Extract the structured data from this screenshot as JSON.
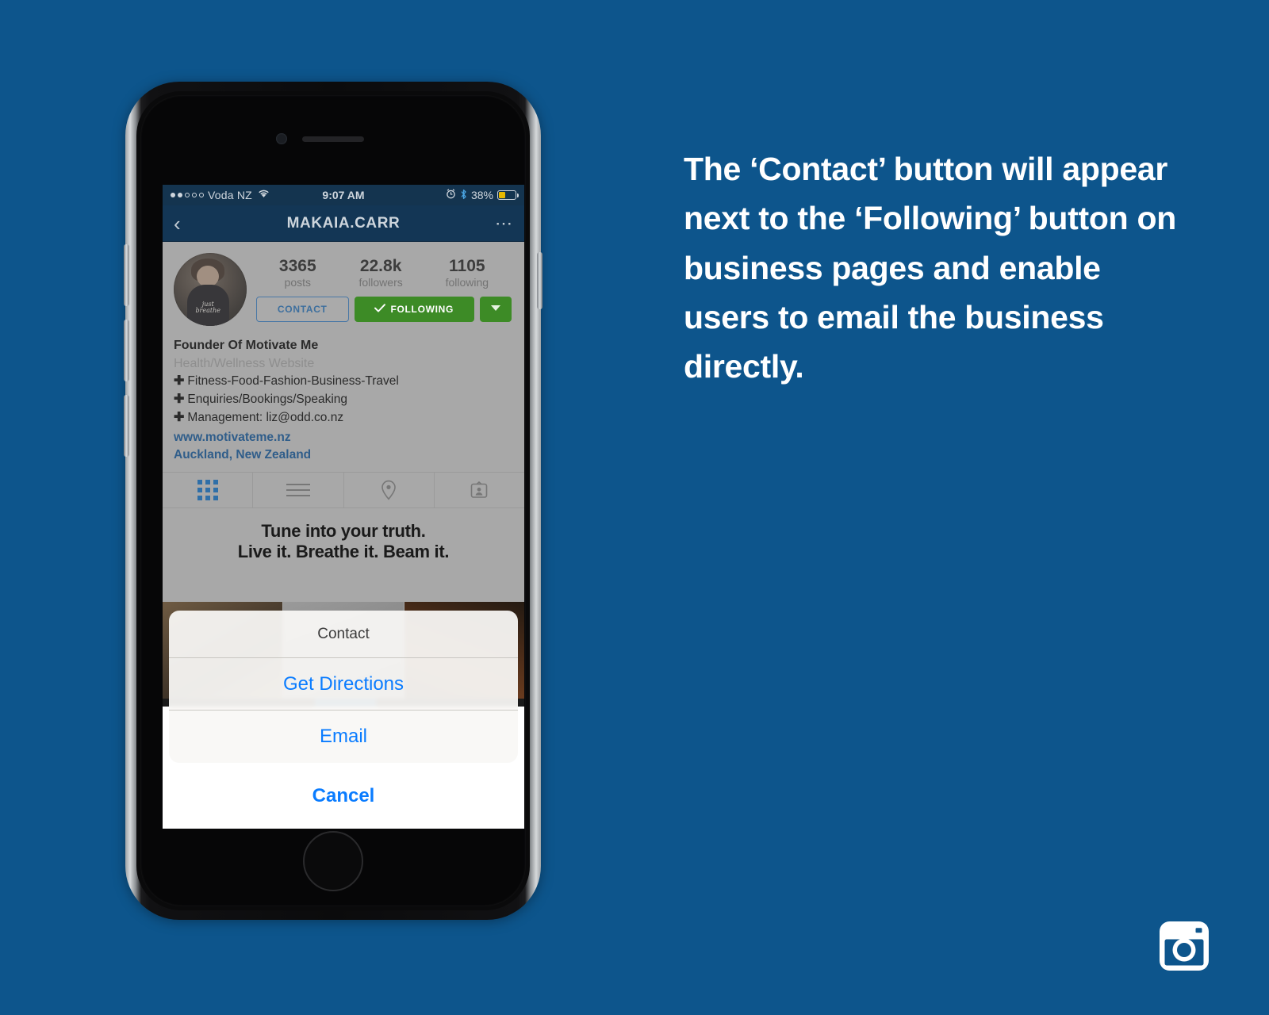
{
  "page": {
    "background_color": "#0d558c",
    "caption": "The ‘Contact’ button will appear next to the ‘Following’ button on business pages and enable users to email the business directly.",
    "logo_name": "instagram-logo"
  },
  "phone": {
    "status_bar": {
      "carrier": "Voda NZ",
      "signal_dots_filled": 2,
      "signal_dots_total": 5,
      "wifi_icon": "wifi-icon",
      "time": "9:07 AM",
      "alarm_icon": "alarm-clock-icon",
      "bluetooth_icon": "bluetooth-icon",
      "battery_percent": "38%",
      "battery_level": 38,
      "battery_color": "#e8b800"
    },
    "nav_bar": {
      "back_icon": "chevron-left-icon",
      "title": "MAKAIA.CARR",
      "more_icon": "ellipsis-icon"
    },
    "profile": {
      "avatar_name": "profile-avatar",
      "avatar_shirt_text": "just breathe",
      "stats": [
        {
          "num": "3365",
          "label": "posts"
        },
        {
          "num": "22.8k",
          "label": "followers"
        },
        {
          "num": "1105",
          "label": "following"
        }
      ],
      "buttons": {
        "contact": "CONTACT",
        "following": "FOLLOWING",
        "following_check_icon": "check-icon",
        "caret_icon": "chevron-down-icon"
      },
      "bio": {
        "name": "Founder Of Motivate Me",
        "category": "Health/Wellness Website",
        "lines": [
          "Fitness-Food-Fashion-Business-Travel",
          "Enquiries/Bookings/Speaking",
          "Management: liz@odd.co.nz"
        ],
        "bullet_icon": "plus-icon",
        "website": "www.motivateme.nz",
        "location": "Auckland, New Zealand",
        "link_color": "#2f5d8a"
      },
      "tabs": [
        {
          "name": "grid-tab",
          "icon": "grid-icon",
          "active": true
        },
        {
          "name": "list-tab",
          "icon": "list-icon",
          "active": false
        },
        {
          "name": "map-tab",
          "icon": "location-pin-icon",
          "active": false
        },
        {
          "name": "tagged-tab",
          "icon": "tagged-photos-icon",
          "active": false
        }
      ],
      "feed_quote_line1": "Tune into your truth.",
      "feed_quote_line2": "Live it. Breathe it. Beam it."
    },
    "action_sheet": {
      "title": "Contact",
      "items": [
        {
          "label": "Get Directions",
          "name": "get-directions-option"
        },
        {
          "label": "Email",
          "name": "email-option"
        }
      ],
      "cancel": "Cancel",
      "accent_color": "#0a7cff"
    }
  }
}
